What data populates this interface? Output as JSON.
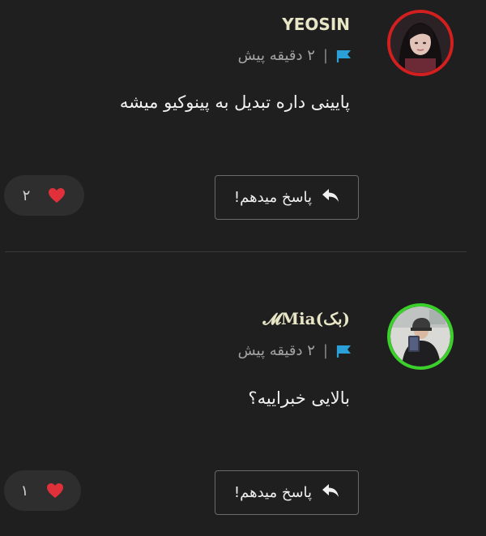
{
  "comments": [
    {
      "username": "YEOSIN",
      "avatar_ring_color": "#d21f1f",
      "time": "۲ دقیقه پیش",
      "separator": "|",
      "text": "پایینی داره تبدیل به پینوکیو میشه",
      "reply_label": "پاسخ میدهم!",
      "like_count": "۲"
    },
    {
      "username": "𝓜Mia(بک)",
      "avatar_ring_color": "#3ad12a",
      "time": "۲ دقیقه پیش",
      "separator": "|",
      "text": "بالایی خبراییه؟",
      "reply_label": "پاسخ میدهم!",
      "like_count": "۱"
    }
  ],
  "colors": {
    "background": "#1f1f1f",
    "flag": "#2a9fd8",
    "heart": "#e0303a",
    "username": "#e8e6c6"
  },
  "icons": {
    "flag": "flag-icon",
    "reply": "reply-arrow-icon",
    "heart": "heart-icon"
  }
}
